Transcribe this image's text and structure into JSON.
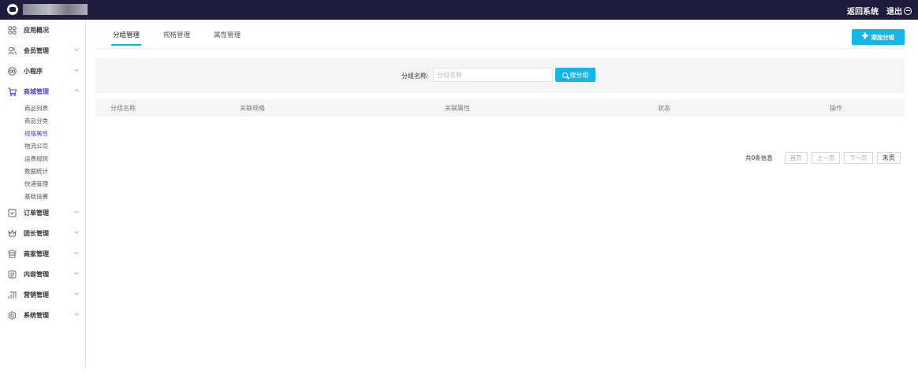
{
  "header": {
    "return_label": "返回系统",
    "logout_label": "退出"
  },
  "sidebar": {
    "items": [
      {
        "label": "应用概况",
        "icon": "grid-icon"
      },
      {
        "label": "会员管理",
        "icon": "users-icon"
      },
      {
        "label": "小程序",
        "icon": "miniprogram-icon"
      },
      {
        "label": "商城管理",
        "icon": "cart-icon",
        "active": true
      },
      {
        "label": "订单管理",
        "icon": "order-icon"
      },
      {
        "label": "团长管理",
        "icon": "crown-icon"
      },
      {
        "label": "商家管理",
        "icon": "store-icon"
      },
      {
        "label": "内容管理",
        "icon": "content-icon"
      },
      {
        "label": "营销管理",
        "icon": "marketing-icon"
      },
      {
        "label": "系统管理",
        "icon": "settings-icon"
      }
    ],
    "sub_items": [
      "商品列表",
      "商品分类",
      "规格属性",
      "物流公司",
      "运费规则",
      "数据统计",
      "快递管理",
      "基础设置"
    ],
    "active_sub": "规格属性"
  },
  "tabs": [
    "分组管理",
    "规格管理",
    "属性管理"
  ],
  "active_tab": "分组管理",
  "add_button_label": "添加分组",
  "filter": {
    "label": "分组名称:",
    "placeholder": "分组名称",
    "search_label": "搜分组"
  },
  "table": {
    "columns": [
      "分组名称",
      "关联规格",
      "关联属性",
      "状态",
      "操作"
    ]
  },
  "pagination": {
    "total_text": "共0条信息",
    "first": "首页",
    "prev": "上一页",
    "next": "下一页",
    "last": "末页"
  },
  "colors": {
    "topbar": "#1f1d3d",
    "accent": "#12b7e6",
    "active_menu": "#4e3ce6"
  }
}
